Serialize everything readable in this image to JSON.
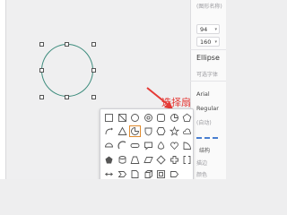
{
  "inspector": {
    "shape_name_placeholder": "(图形名称)",
    "field_1_value": "94",
    "field_2_value": "160",
    "section_title": "Ellipse",
    "fill_label": "可选字体",
    "font_family_value": "Arial",
    "font_weight_value": "Regular",
    "font_size_placeholder": "(自动)",
    "bottom_label_1": "结构",
    "bottom_label_2": "描边",
    "bottom_label_3": "颜色"
  },
  "annotation": {
    "text": "选择扇形",
    "color": "#e53935"
  },
  "colors": {
    "shape_stroke": "#3d8c7d",
    "accent": "#4a7fd0",
    "selection_border": "#e08b2e"
  },
  "shape_picker": {
    "shapes": [
      [
        "square",
        "square-diagonal",
        "circle",
        "ring",
        "rounded-square",
        "circle-outline",
        "pentagon"
      ],
      [
        "arrow-curve",
        "triangle",
        "pie-sector",
        "shield",
        "hexagon",
        "star",
        "cloud"
      ],
      [
        "half-circle",
        "arc",
        "rounded-bar",
        "bubble",
        "drop",
        "heart",
        "quarter"
      ],
      [
        "pentagon-outline",
        "cylinder",
        "trapezoid",
        "parallelogram",
        "diamond",
        "cross",
        "bracket"
      ],
      [
        "double-arrow",
        "chevron",
        "doc",
        "cube",
        "frame",
        "tag",
        "blank"
      ]
    ]
  }
}
